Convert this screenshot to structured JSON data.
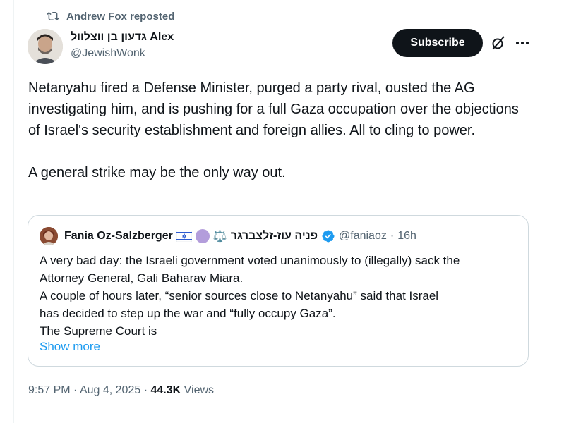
{
  "repost": {
    "text": "Andrew Fox reposted"
  },
  "author": {
    "display_name": "גדעון בן ווצלוול Alex",
    "handle": "@JewishWonk"
  },
  "actions": {
    "subscribe_label": "Subscribe"
  },
  "tweet": {
    "paragraph_1": "Netanyahu fired a Defense Minister, purged a party rival, ousted the AG investigating him, and is pushing for a full Gaza occupation over the objections of Israel's security establishment and foreign allies. All to cling to power.",
    "paragraph_2": "A general strike may be the only way out."
  },
  "quote": {
    "name": "Fania Oz-Salzberger",
    "scales_emoji": "⚖️",
    "hebrew_name": "פניה עוז-זלצברגר",
    "handle": "@faniaoz",
    "separator": "·",
    "time": "16h",
    "lines": [
      "A very bad day: the Israeli government voted unanimously to (illegally) sack the",
      "Attorney General, Gali Baharav Miara.",
      "A couple of hours later, “senior sources close to Netanyahu” said that Israel",
      "has decided to step up the war and “fully occupy Gaza”.",
      "The Supreme Court is"
    ],
    "show_more": "Show more"
  },
  "meta": {
    "time": "9:57 PM",
    "sep1": "·",
    "date": "Aug 4, 2025",
    "sep2": "·",
    "views_count": "44.3K",
    "views_label": "Views"
  },
  "colors": {
    "text_primary": "#0f1419",
    "text_secondary": "#536471",
    "link_blue": "#1d9bf0",
    "border": "#cfd9de"
  },
  "icons": {
    "repost": "repost-icon",
    "grok": "grok-icon",
    "more": "more-icon",
    "verified": "verified-badge-icon"
  }
}
